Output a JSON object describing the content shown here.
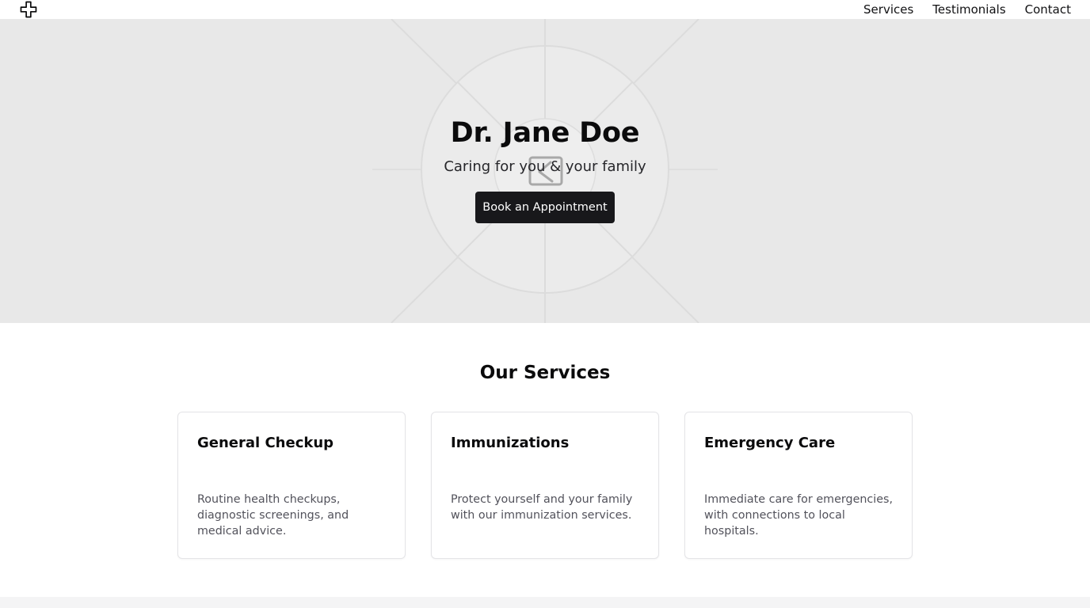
{
  "header": {
    "logo_icon": "medical-cross-icon",
    "nav": [
      {
        "label": "Services"
      },
      {
        "label": "Testimonials"
      },
      {
        "label": "Contact"
      }
    ]
  },
  "hero": {
    "title": "Dr. Jane Doe",
    "subtitle": "Caring for you & your family",
    "cta_label": "Book an Appointment",
    "placeholder_icon": "image-placeholder-icon",
    "background_color": "#e8e8e8"
  },
  "services": {
    "title": "Our Services",
    "cards": [
      {
        "title": "General Checkup",
        "description": "Routine health checkups, diagnostic screenings, and medical advice."
      },
      {
        "title": "Immunizations",
        "description": "Protect yourself and your family with our immunization services."
      },
      {
        "title": "Emergency Care",
        "description": "Immediate care for emergencies, with connections to local hospitals."
      }
    ]
  },
  "colors": {
    "button_bg": "#18181b",
    "button_text": "#ffffff",
    "muted_text": "#52525b",
    "card_border": "#e4e4e7"
  }
}
